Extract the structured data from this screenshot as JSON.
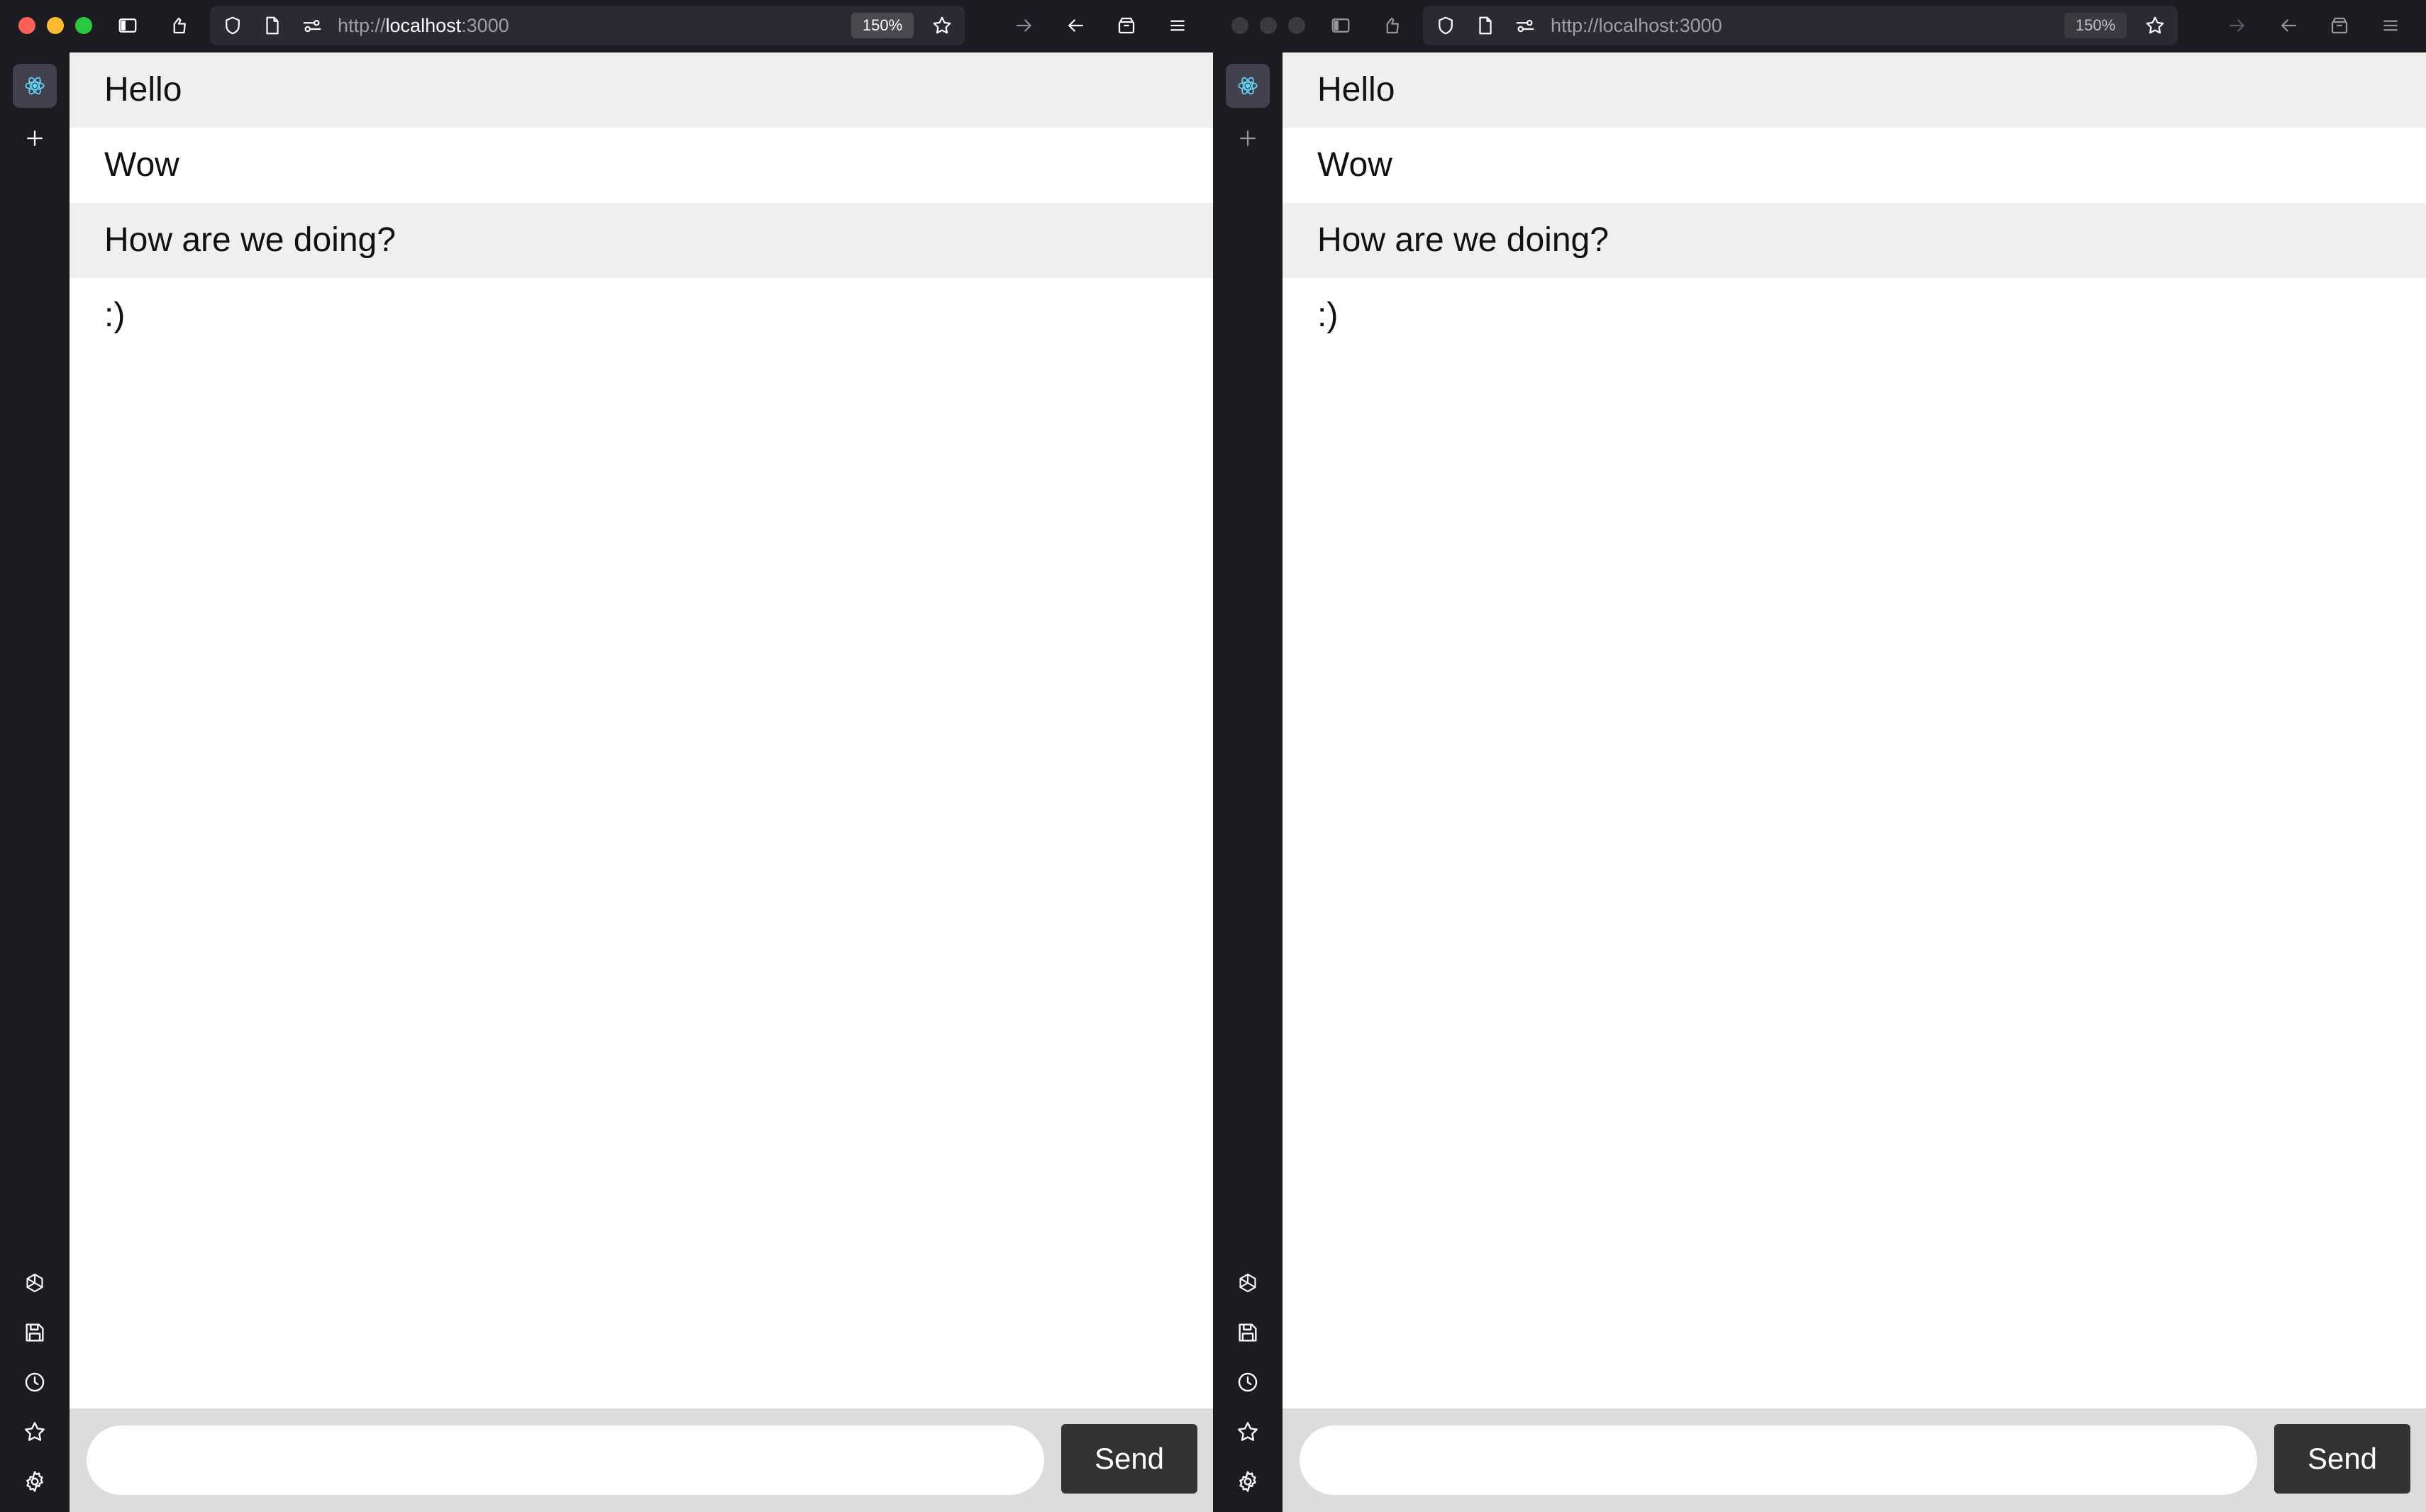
{
  "windows": [
    {
      "focused": true,
      "toolbar": {
        "url_scheme": "http://",
        "url_host": "localhost",
        "url_port": ":3000",
        "zoom": "150%"
      },
      "messages": [
        {
          "text": "Hello"
        },
        {
          "text": "Wow"
        },
        {
          "text": "How are we doing?"
        },
        {
          "text": ":)"
        }
      ],
      "composer": {
        "placeholder": "",
        "value": "",
        "send_label": "Send"
      }
    },
    {
      "focused": false,
      "toolbar": {
        "url_scheme": "http://",
        "url_host": "localhost",
        "url_port": ":3000",
        "zoom": "150%"
      },
      "messages": [
        {
          "text": "Hello"
        },
        {
          "text": "Wow"
        },
        {
          "text": "How are we doing?"
        },
        {
          "text": ":)"
        }
      ],
      "composer": {
        "placeholder": "",
        "value": "",
        "send_label": "Send"
      }
    }
  ],
  "colors": {
    "traffic_close": "#ff5f57",
    "traffic_minimize": "#febc2e",
    "traffic_zoom": "#28c840",
    "react_icon": "#61dafb"
  },
  "sidebar_icons": [
    "react-app-icon",
    "plus-icon",
    "openai-icon",
    "save-icon",
    "clock-icon",
    "star-icon",
    "gear-icon"
  ]
}
